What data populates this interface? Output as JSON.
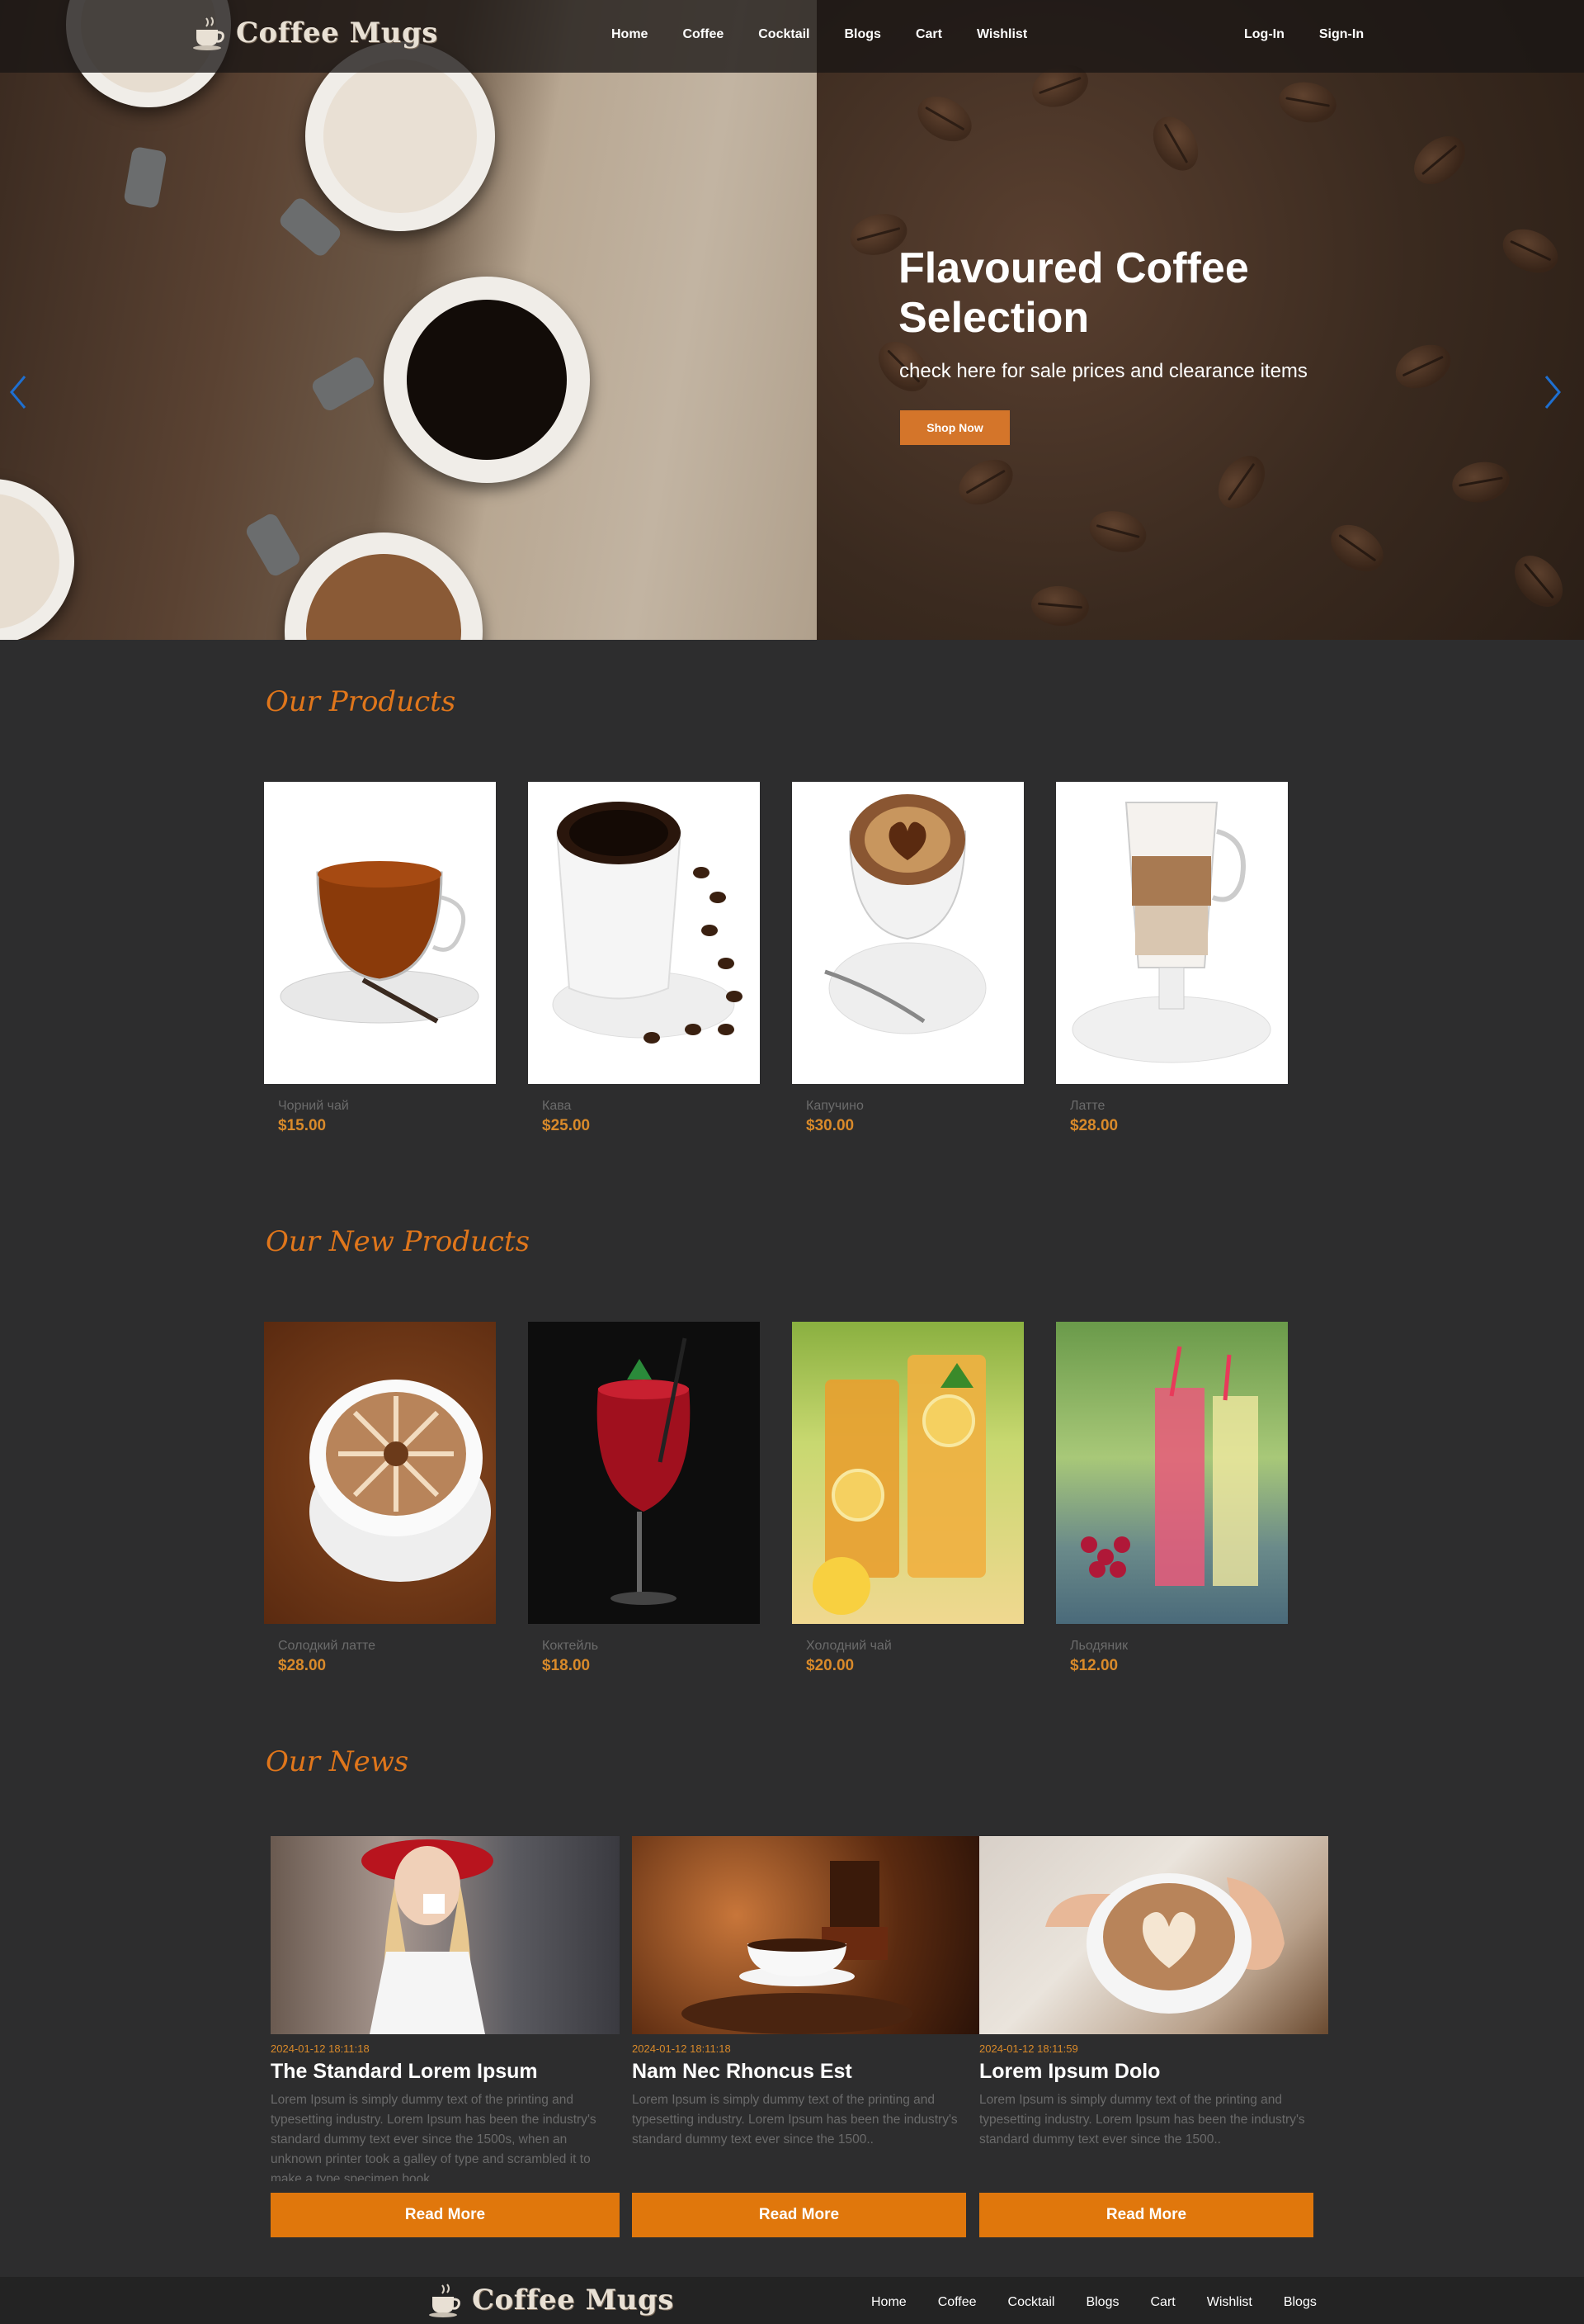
{
  "header": {
    "logo_text": "Coffee Mugs",
    "nav": [
      "Home",
      "Coffee",
      "Cocktail",
      "Blogs",
      "Cart",
      "Wishlist"
    ],
    "auth": [
      "Log-In",
      "Sign-In"
    ]
  },
  "hero": {
    "title": "Flavoured Coffee Selection",
    "subtitle": "check here for sale prices and clearance items",
    "button": "Shop Now"
  },
  "products": {
    "title": "Our Products",
    "items": [
      {
        "name": "Чорний чай",
        "price": "$15.00"
      },
      {
        "name": "Кава",
        "price": "$25.00"
      },
      {
        "name": "Капучино",
        "price": "$30.00"
      },
      {
        "name": "Латте",
        "price": "$28.00"
      }
    ]
  },
  "new_products": {
    "title": "Our New Products",
    "items": [
      {
        "name": "Солодкий латте",
        "price": "$28.00"
      },
      {
        "name": "Коктейль",
        "price": "$18.00"
      },
      {
        "name": "Холодний чай",
        "price": "$20.00"
      },
      {
        "name": "Льодяник",
        "price": "$12.00"
      }
    ]
  },
  "news": {
    "title": "Our News",
    "items": [
      {
        "date": "2024-01-12 18:11:18",
        "title": "The Standard Lorem Ipsum",
        "text": "Lorem Ipsum is simply dummy text of the printing and typesetting industry. Lorem Ipsum has been the industry's standard dummy text ever since the 1500s, when an unknown printer took a galley of type and scrambled it to make a type specimen book.",
        "button": "Read More"
      },
      {
        "date": "2024-01-12 18:11:18",
        "title": "Nam Nec Rhoncus Est",
        "text": "Lorem Ipsum is simply dummy text of the printing and typesetting industry. Lorem Ipsum has been the industry's standard dummy text ever since the 1500..",
        "button": "Read More"
      },
      {
        "date": "2024-01-12 18:11:59",
        "title": "Lorem Ipsum Dolo",
        "text": "Lorem Ipsum is simply dummy text of the printing and typesetting industry. Lorem Ipsum has been the industry's standard dummy text ever since the 1500..",
        "button": "Read More"
      }
    ]
  },
  "footer": {
    "logo_text": "Coffee Mugs",
    "nav": [
      "Home",
      "Coffee",
      "Cocktail",
      "Blogs",
      "Cart",
      "Wishlist",
      "Blogs"
    ]
  },
  "colors": {
    "accent": "#e0770c",
    "background": "#2d2d2e",
    "price": "#d98a2a"
  }
}
